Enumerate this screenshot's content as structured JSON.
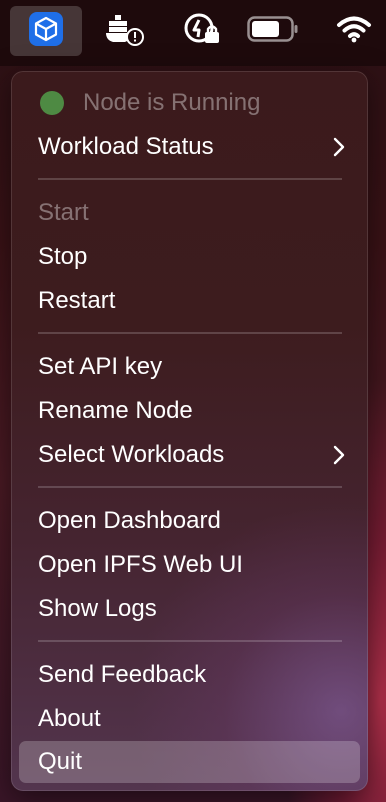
{
  "menubar": {
    "icons": [
      {
        "name": "app-cube-icon",
        "active": true
      },
      {
        "name": "docker-warning-icon"
      },
      {
        "name": "security-lock-icon"
      },
      {
        "name": "battery-icon"
      },
      {
        "name": "wifi-icon"
      }
    ]
  },
  "menu": {
    "status": {
      "label": "Node is Running",
      "dot_color": "#4e8a43"
    },
    "items": {
      "workload_status": "Workload Status",
      "start": "Start",
      "stop": "Stop",
      "restart": "Restart",
      "set_api_key": "Set API key",
      "rename_node": "Rename Node",
      "select_workloads": "Select Workloads",
      "open_dashboard": "Open Dashboard",
      "open_ipfs_web_ui": "Open IPFS Web UI",
      "show_logs": "Show Logs",
      "send_feedback": "Send Feedback",
      "about": "About",
      "quit": "Quit"
    }
  }
}
